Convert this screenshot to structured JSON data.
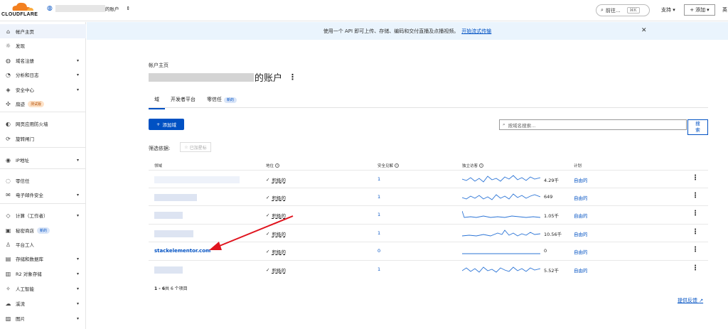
{
  "topbar": {
    "logo_text": "CLOUDFLARE",
    "account_suffix": "的账户",
    "search_label": "前往...",
    "search_shortcut": "⌘K",
    "support": "支持",
    "add": "添加",
    "lang": "英"
  },
  "sidebar": {
    "items": [
      {
        "label": "帐户主页",
        "icon": "home-icon",
        "glyph": "⌂"
      },
      {
        "label": "发现",
        "icon": "lightbulb-icon",
        "glyph": "☼"
      },
      {
        "label": "域名注册",
        "icon": "globe-icon",
        "glyph": "◍"
      },
      {
        "label": "分析和日志",
        "icon": "clock-icon",
        "glyph": "◔"
      },
      {
        "label": "安全中心",
        "icon": "shield-icon",
        "glyph": "◈"
      },
      {
        "label": "扇迹",
        "icon": "trace-icon",
        "glyph": "✣",
        "badge": "测试版"
      },
      {
        "label": "网页应用防火墙",
        "icon": "firewall-icon",
        "glyph": "◐"
      },
      {
        "label": "旋转闸门",
        "icon": "turnstile-icon",
        "glyph": "⟳"
      },
      {
        "label": "IP地址",
        "icon": "location-icon",
        "glyph": "◉"
      },
      {
        "label": "零信任",
        "icon": "zero-trust-icon",
        "glyph": "◌"
      },
      {
        "label": "电子邮件安全",
        "icon": "mail-icon",
        "glyph": "✉"
      },
      {
        "label": "计算（工作者）",
        "icon": "compute-icon",
        "glyph": "◇"
      },
      {
        "label": "秘密商店",
        "icon": "lock-icon",
        "glyph": "▣",
        "badge": "新的"
      },
      {
        "label": "平台工人",
        "icon": "platform-icon",
        "glyph": "♙"
      },
      {
        "label": "存储和数据库",
        "icon": "database-icon",
        "glyph": "▤"
      },
      {
        "label": "R2 对象存储",
        "icon": "storage-icon",
        "glyph": "▥"
      },
      {
        "label": "人工智能",
        "icon": "ai-icon",
        "glyph": "✧"
      },
      {
        "label": "溪流",
        "icon": "cloud-icon",
        "glyph": "☁"
      },
      {
        "label": "图片",
        "icon": "image-icon",
        "glyph": "▨"
      }
    ]
  },
  "banner": {
    "text": "使用一个 API 即可上传、存储、编码和交付直播及点播视频。",
    "link": "开始流式传输"
  },
  "main": {
    "breadcrumb": "帐户主页",
    "title_suffix": "的账户",
    "tabs": [
      {
        "label": "域"
      },
      {
        "label": "开发者平台"
      },
      {
        "label": "零信任",
        "badge": "新的"
      }
    ],
    "add_domain": "添加域",
    "search_placeholder": "按域名搜索...",
    "search_button": "搜索",
    "filter_label": "筛选依据:",
    "filter_starred": "已加星标",
    "columns": [
      "领域",
      "地位",
      "安全见解",
      "独立访客",
      "计划"
    ],
    "rows": [
      {
        "domain": "",
        "status": "积极的",
        "insights": "1",
        "visits": "4.29千",
        "plan": "自由的"
      },
      {
        "domain": "",
        "status": "积极的",
        "insights": "1",
        "visits": "649",
        "plan": "自由的"
      },
      {
        "domain": "",
        "status": "积极的",
        "insights": "1",
        "visits": "1.05千",
        "plan": "自由的"
      },
      {
        "domain": "",
        "status": "积极的",
        "insights": "1",
        "visits": "10.56千",
        "plan": "自由的"
      },
      {
        "domain": "stackelementor.com",
        "status": "积极的",
        "insights": "0",
        "visits": "0",
        "plan": "自由的"
      },
      {
        "domain": "",
        "status": "积极的",
        "insights": "1",
        "visits": "5.52千",
        "plan": "自由的"
      }
    ],
    "pager_range": "1 - 6",
    "pager_total": "共 6 个项目",
    "feedback": "提供反馈"
  },
  "colors": {
    "accent": "#0051c3",
    "banner_bg": "#eaf4fd",
    "logo_orange": "#f38020"
  }
}
